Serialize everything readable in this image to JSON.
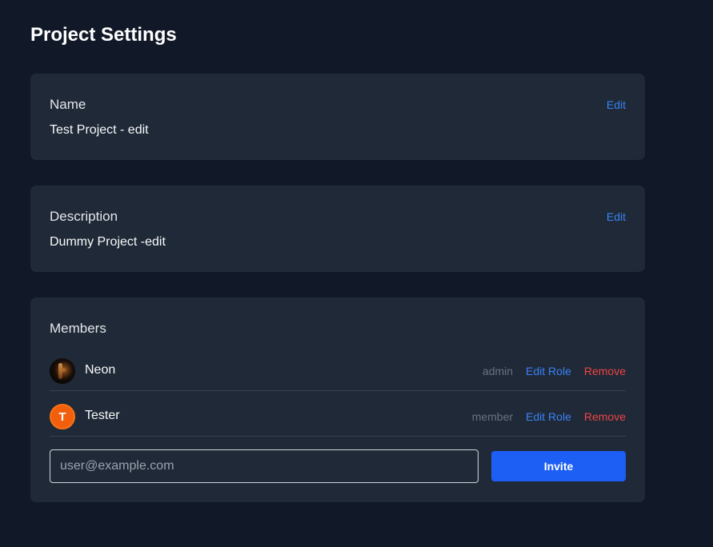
{
  "page": {
    "title": "Project Settings"
  },
  "name_card": {
    "title": "Name",
    "value": "Test Project - edit",
    "edit_label": "Edit"
  },
  "description_card": {
    "title": "Description",
    "value": "Dummy Project -edit",
    "edit_label": "Edit"
  },
  "members_card": {
    "title": "Members",
    "members": [
      {
        "name": "Neon",
        "role": "admin",
        "avatar": "photo",
        "edit_role_label": "Edit Role",
        "remove_label": "Remove"
      },
      {
        "name": "Tester",
        "role": "member",
        "avatar_letter": "T",
        "edit_role_label": "Edit Role",
        "remove_label": "Remove"
      }
    ],
    "invite": {
      "placeholder": "user@example.com",
      "value": "",
      "button_label": "Invite"
    }
  },
  "colors": {
    "background": "#111827",
    "card": "#1f2937",
    "link": "#3b82f6",
    "danger": "#ef4444",
    "primary_button": "#1d5ef5",
    "avatar_accent": "#f25f0c"
  }
}
